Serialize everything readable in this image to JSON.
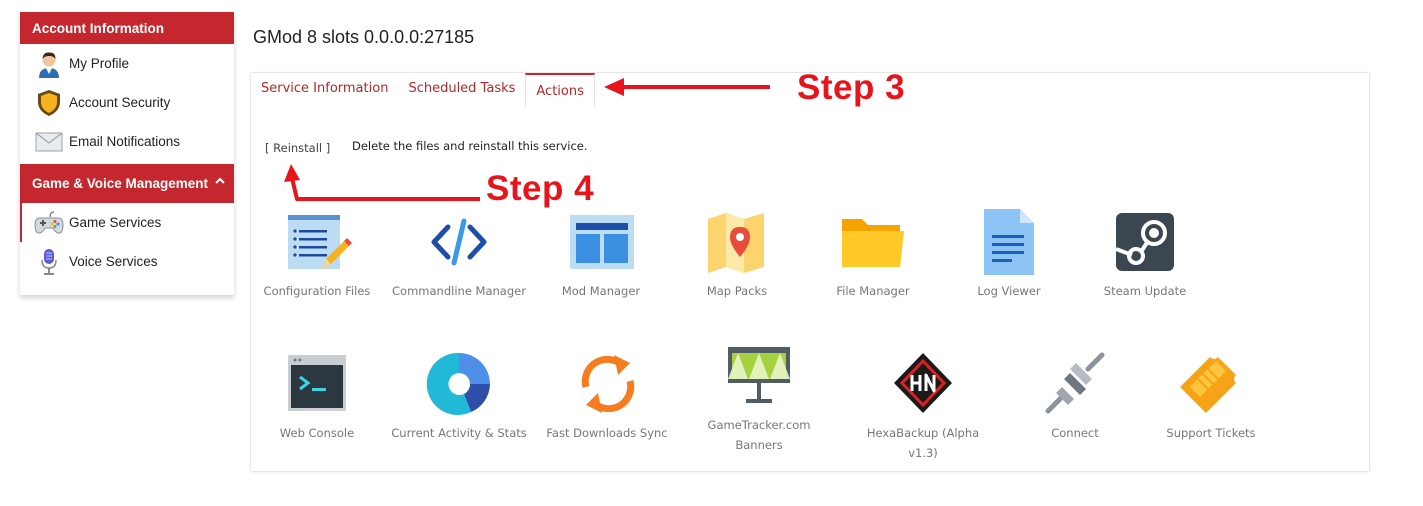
{
  "sidebar": {
    "account_header": "Account Information",
    "account_items": [
      {
        "label": "My Profile",
        "icon": "user-avatar-icon"
      },
      {
        "label": "Account Security",
        "icon": "shield-icon"
      },
      {
        "label": "Email Notifications",
        "icon": "envelope-icon"
      }
    ],
    "game_header": "Game & Voice Management",
    "game_items": [
      {
        "label": "Game Services",
        "icon": "gamepad-icon"
      },
      {
        "label": "Voice Services",
        "icon": "microphone-icon"
      }
    ]
  },
  "page": {
    "title": "GMod 8 slots 0.0.0.0:27185"
  },
  "tabs": [
    "Service Information",
    "Scheduled Tasks",
    "Actions"
  ],
  "active_tab": "Actions",
  "actions": {
    "reinstall_label": "[ Reinstall ]",
    "reinstall_description": "Delete the files and reinstall this service."
  },
  "tools": [
    {
      "label": "Configuration Files",
      "icon": "config-file-icon"
    },
    {
      "label": "Commandline Manager",
      "icon": "code-icon"
    },
    {
      "label": "Mod Manager",
      "icon": "layout-icon"
    },
    {
      "label": "Map Packs",
      "icon": "map-icon"
    },
    {
      "label": "File Manager",
      "icon": "folder-icon"
    },
    {
      "label": "Log Viewer",
      "icon": "document-icon"
    },
    {
      "label": "Steam Update",
      "icon": "steam-icon"
    },
    {
      "label": "Web Console",
      "icon": "terminal-icon"
    },
    {
      "label": "Current Activity & Stats",
      "icon": "donut-chart-icon"
    },
    {
      "label": "Fast Downloads Sync",
      "icon": "sync-icon"
    },
    {
      "label": "GameTracker.com Banners",
      "icon": "billboard-icon"
    },
    {
      "label": "HexaBackup (Alpha v1.3)",
      "icon": "hexabackup-icon"
    },
    {
      "label": "Connect",
      "icon": "plug-icon"
    },
    {
      "label": "Support Tickets",
      "icon": "ticket-icon"
    }
  ],
  "annotations": {
    "step3": "Step 3",
    "step4": "Step 4"
  },
  "colors": {
    "accent": "#c4282e",
    "annotation": "#e8141c",
    "tab_text": "#b2282c"
  }
}
